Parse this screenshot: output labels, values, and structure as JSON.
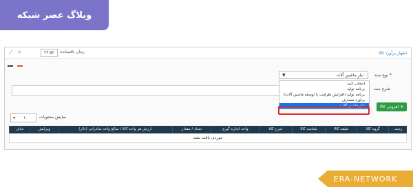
{
  "brand": {
    "title": "وبلاگ عصر شبکه"
  },
  "topbar": {
    "page_title": "اظهار برآورد کالا",
    "timer_label": "زمان باقیمانده",
    "timer_value": "۲۳:۵۲",
    "icons": [
      "expand-icon",
      "close-icon"
    ]
  },
  "form": {
    "doc_type_label": "* نوع سند",
    "doc_type_selected": "نیاز ماشین آلات",
    "description_label": "شرح سند",
    "options": [
      "انتخاب کنید",
      "برنامه تولید",
      "برنامه تولید (افزایش ظرفیت یا توسعه ماشین آلات)",
      "برآورد مصارف",
      "نیاز ماشین آلات"
    ]
  },
  "toolbar": {
    "add_item_label": "افزودن کالا"
  },
  "table": {
    "page_size": "۱۰",
    "page_size_label": "نمایش محتویات",
    "columns": [
      "ردیف",
      "گروه کالا",
      "طبقه کالا",
      "شناسه کالا",
      "شرح کالا",
      "واحد اندازه گیری",
      "تعداد / مقدار",
      "ارزش هر واحد کالا / مبالغ واحد صادراتی (دلار)",
      "ویرایش",
      "حذف"
    ],
    "empty_message": "موردی یافت نشد"
  },
  "watermark": {
    "text": "ERA-NETWORK"
  }
}
